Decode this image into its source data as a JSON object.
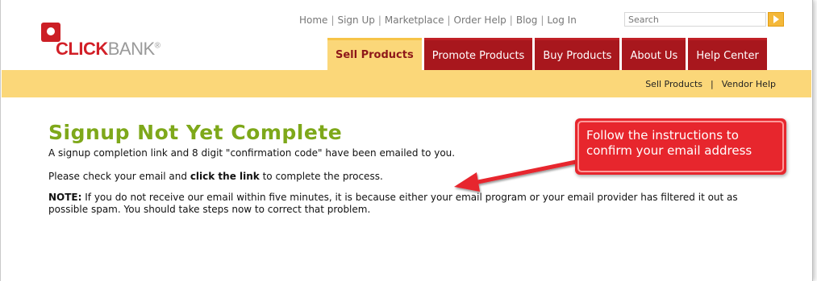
{
  "logo": {
    "click": "CLICK",
    "bank": "BANK",
    "reg": "®"
  },
  "toplinks": [
    "Home",
    "Sign Up",
    "Marketplace",
    "Order Help",
    "Blog",
    "Log In"
  ],
  "toplinks_sep": "|",
  "search": {
    "placeholder": "Search"
  },
  "tabs": [
    "Sell Products",
    "Promote Products",
    "Buy Products",
    "About Us",
    "Help Center"
  ],
  "active_tab": "Sell Products",
  "subnav": {
    "sell": "Sell Products",
    "sep": "|",
    "vendor": "Vendor Help"
  },
  "content": {
    "title": "Signup Not Yet Complete",
    "p1": "A signup completion link and 8 digit \"confirmation code\" have been emailed to you.",
    "p2_pre": "Please check your email and ",
    "p2_bold": "click the link",
    "p2_post": " to complete the process.",
    "p3_bold": "NOTE:",
    "p3_rest": " If you do not receive our email within five minutes, it is because either your email program or your email provider has filtered it out as possible spam. You should take steps now to correct that problem."
  },
  "callout": {
    "line1": "Follow the instructions to",
    "line2": "confirm your email address"
  },
  "colors": {
    "brand_red": "#a8171d",
    "tab_active": "#fbd779",
    "title_green": "#7ea81a",
    "callout_red": "#e7262d"
  }
}
